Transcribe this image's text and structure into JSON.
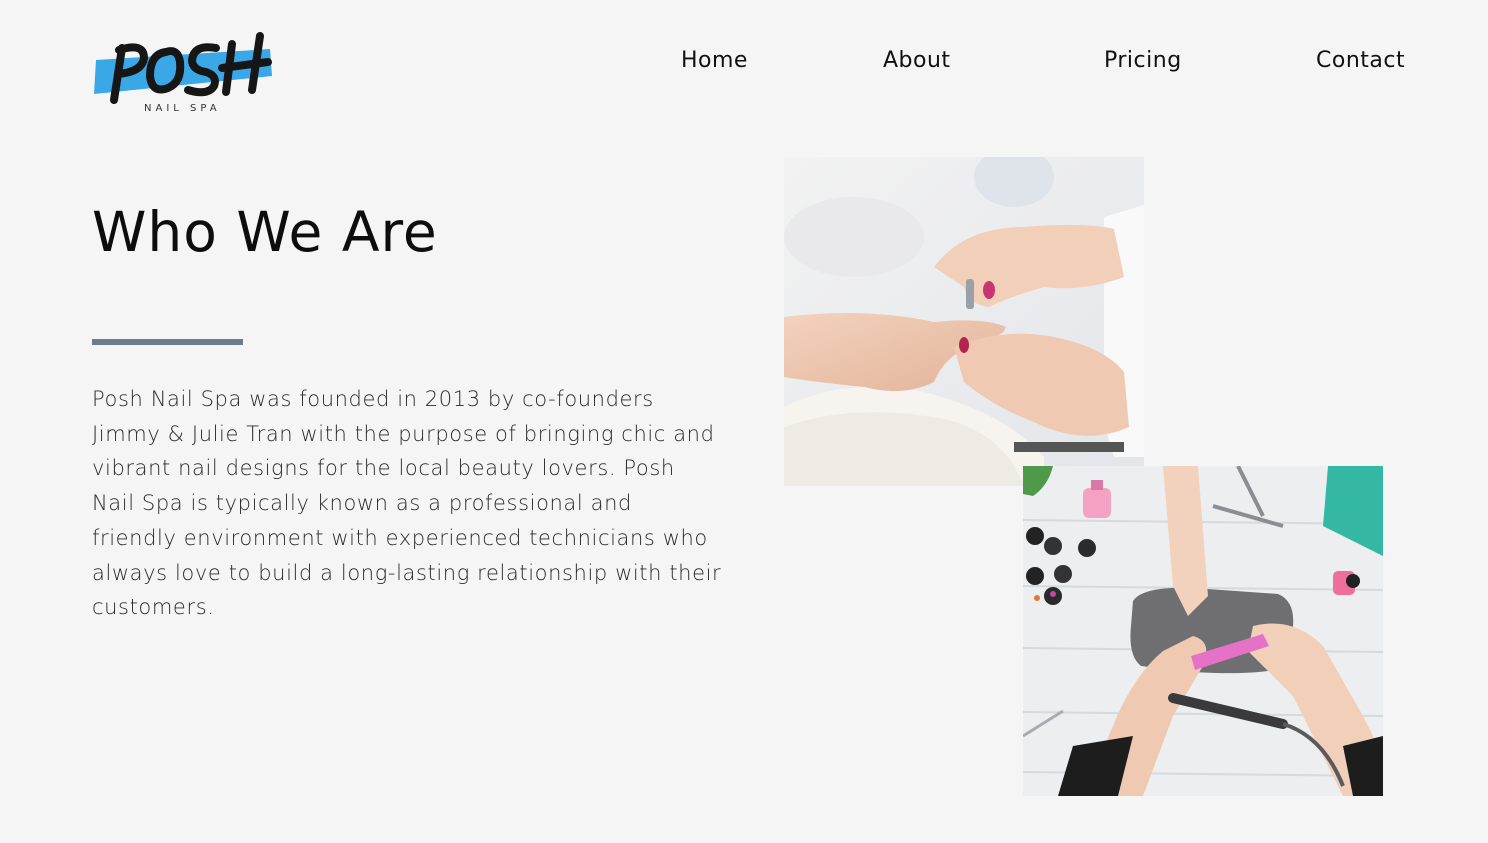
{
  "brand": {
    "name": "POSH",
    "tagline": "NAIL SPA",
    "accent_color": "#3aa8e6"
  },
  "nav": {
    "items": [
      {
        "label": "Home"
      },
      {
        "label": "About"
      },
      {
        "label": "Pricing"
      },
      {
        "label": "Contact"
      }
    ]
  },
  "about": {
    "title": "Who We Are",
    "body": "Posh Nail Spa was founded in 2013 by co-founders Jimmy & Julie Tran with the purpose of bringing chic and vibrant nail designs for the local beauty lovers. Posh Nail Spa is typically known as a professional and friendly environment with experienced technicians who always love to build a long-lasting relationship with their customers.",
    "rule_color": "#6e7b8b"
  },
  "photos": [
    {
      "subject": "manicure-closeup-photo"
    },
    {
      "subject": "manicure-table-overhead-photo"
    }
  ]
}
